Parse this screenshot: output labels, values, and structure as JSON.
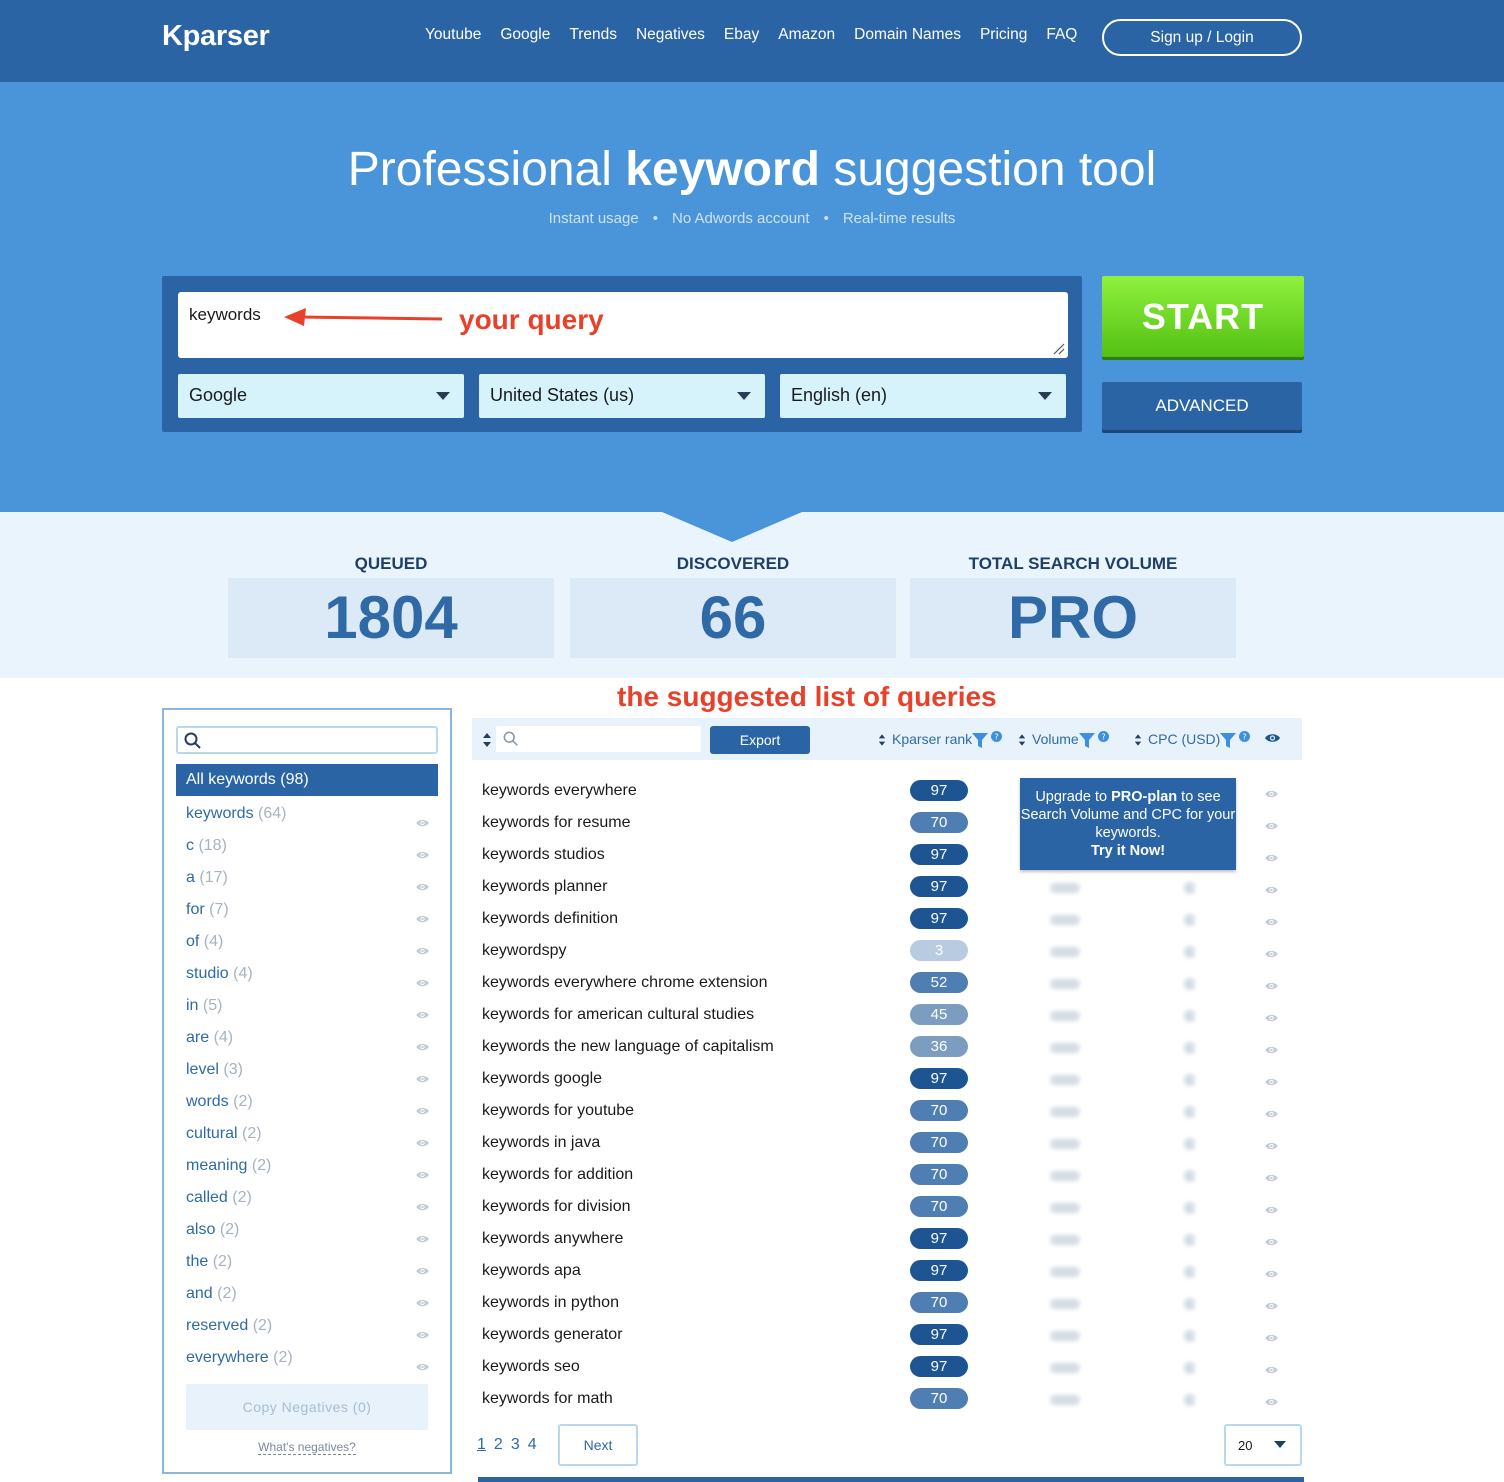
{
  "brand": "Kparser",
  "nav": [
    "Youtube",
    "Google",
    "Trends",
    "Negatives",
    "Ebay",
    "Amazon",
    "Domain Names",
    "Pricing",
    "FAQ"
  ],
  "login_label": "Sign up / Login",
  "hero": {
    "title_pre": "Professional ",
    "title_bold": "keyword",
    "title_post": " suggestion tool",
    "sub1": "Instant usage",
    "sub2": "No Adwords account",
    "sub3": "Real-time results",
    "sep": "•"
  },
  "query": {
    "value": "keywords",
    "annotation": "your query"
  },
  "selects": {
    "engine": "Google",
    "country": "United States (us)",
    "language": "English (en)"
  },
  "buttons": {
    "start": "START",
    "advanced": "ADVANCED",
    "export": "Export",
    "copy_negatives": "Copy Negatives (0)",
    "whats_negatives": "What's negatives?",
    "next": "Next"
  },
  "stats": {
    "queued_label": "QUEUED",
    "queued_value": "1804",
    "discovered_label": "DISCOVERED",
    "discovered_value": "66",
    "volume_label": "TOTAL SEARCH VOLUME",
    "volume_value": "PRO"
  },
  "list_annotation": "the suggested list of queries",
  "filters": {
    "all": "All keywords (98)",
    "items": [
      {
        "word": "keywords",
        "count": "(64)"
      },
      {
        "word": "c",
        "count": "(18)"
      },
      {
        "word": "a",
        "count": "(17)"
      },
      {
        "word": "for",
        "count": "(7)"
      },
      {
        "word": "of",
        "count": "(4)"
      },
      {
        "word": "studio",
        "count": "(4)"
      },
      {
        "word": "in",
        "count": "(5)"
      },
      {
        "word": "are",
        "count": "(4)"
      },
      {
        "word": "level",
        "count": "(3)"
      },
      {
        "word": "words",
        "count": "(2)"
      },
      {
        "word": "cultural",
        "count": "(2)"
      },
      {
        "word": "meaning",
        "count": "(2)"
      },
      {
        "word": "called",
        "count": "(2)"
      },
      {
        "word": "also",
        "count": "(2)"
      },
      {
        "word": "the",
        "count": "(2)"
      },
      {
        "word": "and",
        "count": "(2)"
      },
      {
        "word": "reserved",
        "count": "(2)"
      },
      {
        "word": "everywhere",
        "count": "(2)"
      }
    ]
  },
  "columns": {
    "rank": "Kparser rank",
    "volume": "Volume",
    "cpc": "CPC (USD)"
  },
  "upgrade": {
    "pre": "Upgrade to ",
    "bold": "PRO-plan",
    "post": " to see Search Volume and CPC for your keywords.",
    "cta": "Try it Now!"
  },
  "keywords": [
    {
      "text": "keywords everywhere",
      "rank": "97"
    },
    {
      "text": "keywords for resume",
      "rank": "70"
    },
    {
      "text": "keywords studios",
      "rank": "97"
    },
    {
      "text": "keywords planner",
      "rank": "97"
    },
    {
      "text": "keywords definition",
      "rank": "97"
    },
    {
      "text": "keywordspy",
      "rank": "3"
    },
    {
      "text": "keywords everywhere chrome extension",
      "rank": "52"
    },
    {
      "text": "keywords for american cultural studies",
      "rank": "45"
    },
    {
      "text": "keywords the new language of capitalism",
      "rank": "36"
    },
    {
      "text": "keywords google",
      "rank": "97"
    },
    {
      "text": "keywords for youtube",
      "rank": "70"
    },
    {
      "text": "keywords in java",
      "rank": "70"
    },
    {
      "text": "keywords for addition",
      "rank": "70"
    },
    {
      "text": "keywords for division",
      "rank": "70"
    },
    {
      "text": "keywords anywhere",
      "rank": "97"
    },
    {
      "text": "keywords apa",
      "rank": "97"
    },
    {
      "text": "keywords in python",
      "rank": "70"
    },
    {
      "text": "keywords generator",
      "rank": "97"
    },
    {
      "text": "keywords seo",
      "rank": "97"
    },
    {
      "text": "keywords for math",
      "rank": "70"
    }
  ],
  "rank_colors": {
    "high": "#1d5592",
    "mid": "#4f7fb2",
    "low": "#7d9dc0",
    "lowest": "#b8cbe0"
  },
  "pages": [
    "1",
    "2",
    "3",
    "4"
  ],
  "per_page": "20"
}
